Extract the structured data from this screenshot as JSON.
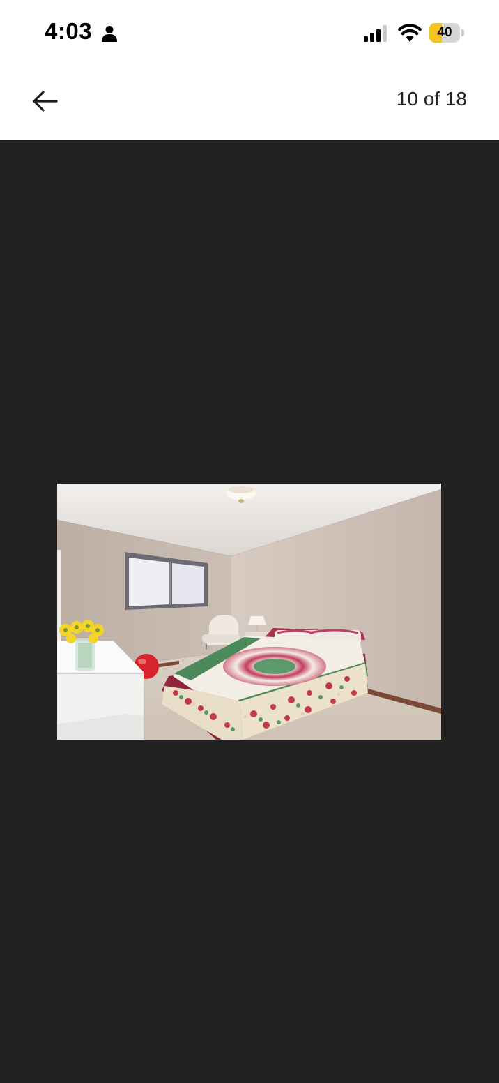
{
  "status_bar": {
    "time": "4:03",
    "battery_level": "40",
    "battery_fraction": 0.4,
    "icons": [
      "person-icon",
      "cellular-signal-icon",
      "wifi-icon",
      "battery-icon"
    ]
  },
  "header": {
    "back_icon": "arrow-left-icon",
    "counter": "10 of 18"
  },
  "viewer": {
    "background_color": "#212121",
    "photo_subject": "bedroom-photo"
  },
  "colors": {
    "battery_yellow": "#f4c51f",
    "viewer_background": "#212121"
  }
}
